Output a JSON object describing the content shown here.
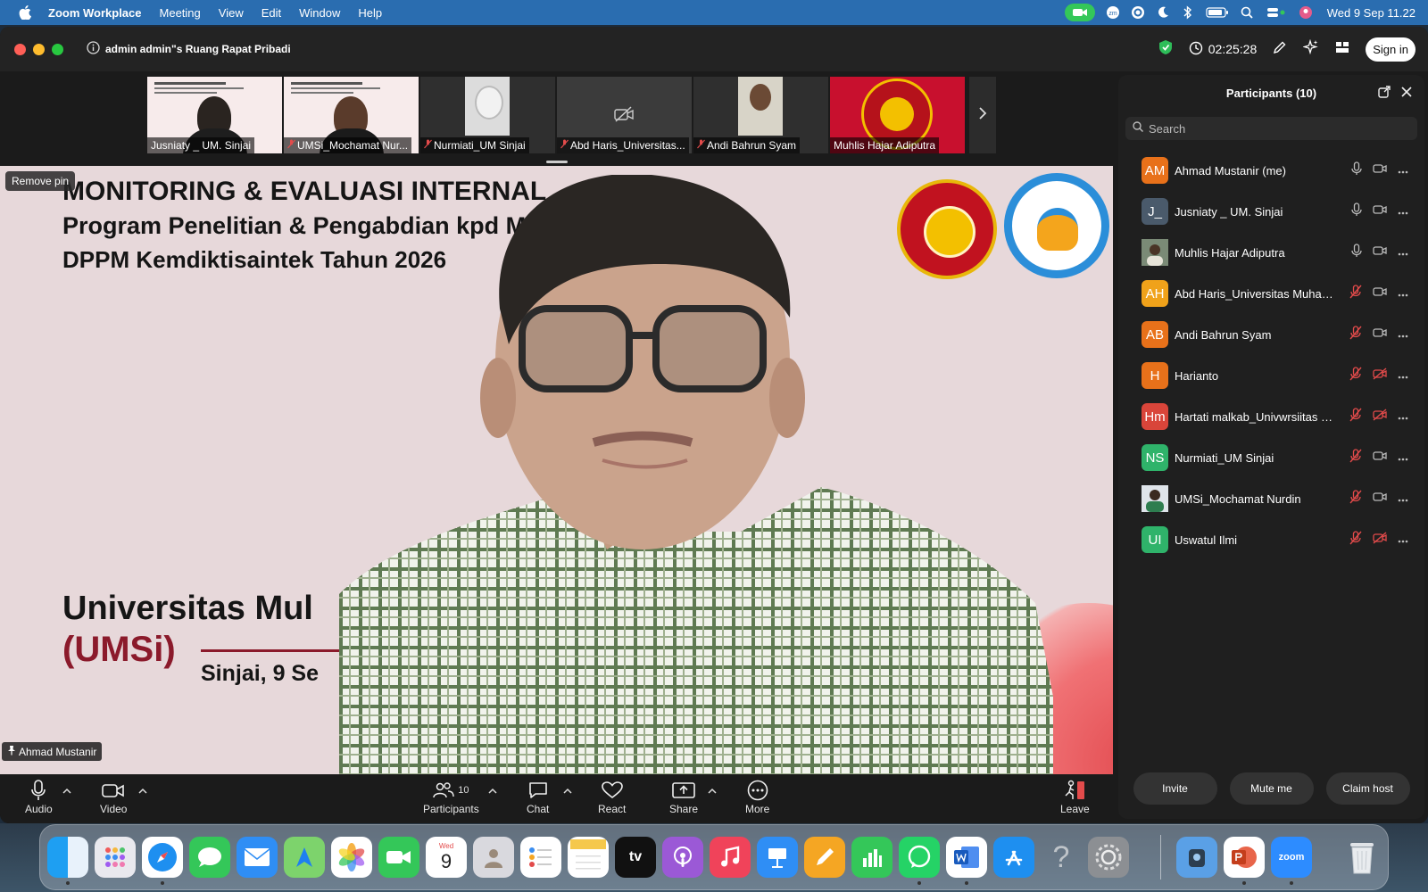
{
  "menubar": {
    "app_name": "Zoom Workplace",
    "menus": [
      "Meeting",
      "View",
      "Edit",
      "Window",
      "Help"
    ],
    "clock": "Wed 9 Sep  11.22"
  },
  "window": {
    "meeting_title": "admin admin\"s Ruang Rapat Pribadi",
    "timer": "02:25:28",
    "sign_in_label": "Sign in"
  },
  "thumbnails": [
    {
      "name": "Jusniaty _ UM. Sinjai",
      "muted": false
    },
    {
      "name": "UMSi_Mochamat Nur...",
      "muted": true
    },
    {
      "name": "Nurmiati_UM Sinjai",
      "muted": true
    },
    {
      "name": "Abd Haris_Universitas...",
      "muted": true
    },
    {
      "name": "Andi Bahrun Syam",
      "muted": true
    },
    {
      "name": "Muhlis  Hajar Adiputra",
      "muted": false
    }
  ],
  "stage": {
    "remove_pin_label": "Remove pin",
    "pinned_name": "Ahmad Mustanir",
    "slide": {
      "title_line1": "MONITORING & EVALUASI INTERNAL",
      "title_line2": "Program Penelitian & Pengabdian kpd M",
      "title_line3": "DPPM Kemdiktisaintek Tahun 2026",
      "university": "Universitas Mul",
      "abbrev": "(UMSi)",
      "date": "Sinjai, 9 Se"
    }
  },
  "participants": {
    "title": "Participants (10)",
    "search_placeholder": "Search",
    "list": [
      {
        "initials": "AM",
        "name": "Ahmad Mustanir (me)",
        "color": "#e8711a",
        "mic_muted": false,
        "video_off": false
      },
      {
        "initials": "J_",
        "name": "Jusniaty _ UM. Sinjai",
        "color": "#4a5a6b",
        "mic_muted": false,
        "video_off": false
      },
      {
        "initials": "",
        "name": "Muhlis  Hajar Adiputra",
        "color": "#2e5b3a",
        "mic_muted": false,
        "video_off": false
      },
      {
        "initials": "AH",
        "name": "Abd Haris_Universitas Muham...",
        "color": "#f0a21a",
        "mic_muted": true,
        "video_off": false
      },
      {
        "initials": "AB",
        "name": "Andi Bahrun Syam",
        "color": "#e8711a",
        "mic_muted": true,
        "video_off": false
      },
      {
        "initials": "H",
        "name": "Harianto",
        "color": "#e8711a",
        "mic_muted": true,
        "video_off": true
      },
      {
        "initials": "Hm",
        "name": "Hartati malkab_Univwrsiitas M...",
        "color": "#d9453a",
        "mic_muted": true,
        "video_off": true
      },
      {
        "initials": "NS",
        "name": "Nurmiati_UM Sinjai",
        "color": "#2fb36a",
        "mic_muted": true,
        "video_off": false
      },
      {
        "initials": "",
        "name": "UMSi_Mochamat Nurdin",
        "color": "#1e3b6b",
        "mic_muted": true,
        "video_off": false
      },
      {
        "initials": "UI",
        "name": "Uswatul Ilmi",
        "color": "#2fb36a",
        "mic_muted": true,
        "video_off": true
      }
    ],
    "invite_label": "Invite",
    "mute_me_label": "Mute me",
    "claim_host_label": "Claim host"
  },
  "toolbar": {
    "audio_label": "Audio",
    "video_label": "Video",
    "participants_label": "Participants",
    "participants_count": "10",
    "chat_label": "Chat",
    "react_label": "React",
    "share_label": "Share",
    "more_label": "More",
    "leave_label": "Leave"
  },
  "dock": {
    "calendar_month": "Wed",
    "calendar_day": "9",
    "tv_label": "tv",
    "zoom_label": "zoom",
    "help_glyph": "?"
  }
}
